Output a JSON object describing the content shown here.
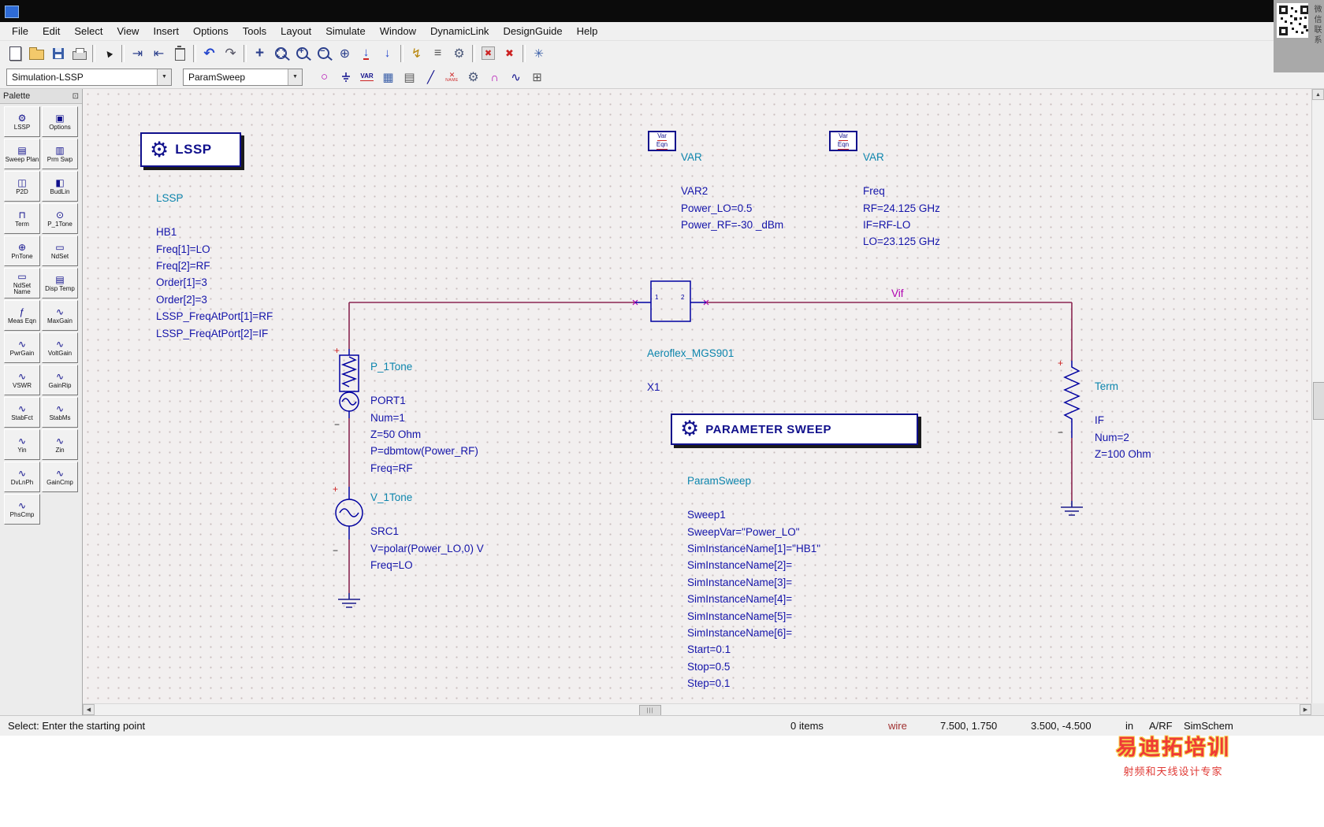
{
  "menu": {
    "items": [
      "File",
      "Edit",
      "Select",
      "View",
      "Insert",
      "Options",
      "Tools",
      "Layout",
      "Simulate",
      "Window",
      "DynamicLink",
      "DesignGuide",
      "Help"
    ]
  },
  "toolbar_main": {
    "icons": [
      "new-design",
      "open-design",
      "save-design",
      "print",
      "select-cursor",
      "push-into-hierarchy",
      "pop-out-hierarchy",
      "delete",
      "undo",
      "redo",
      "move",
      "zoom-area",
      "zoom-in",
      "zoom-out",
      "zoom-full",
      "insert-pin",
      "insert-port",
      "activate",
      "node-name",
      "simulation-setup",
      "deactivate-component",
      "restore-component",
      "preferences"
    ]
  },
  "toolbar_insert": {
    "design_state": "Simulation-LSSP",
    "component_state": "ParamSweep",
    "icons": [
      "insert-polygon",
      "insert-ground",
      "insert-var",
      "display-template",
      "netlist-include",
      "insert-wire",
      "wire-label",
      "simulation-gear",
      "current-probe",
      "measurement-plot",
      "hierarchy"
    ]
  },
  "palette": {
    "title": "Palette",
    "items": [
      {
        "label": "LSSP",
        "glyph": "⚙"
      },
      {
        "label": "Options",
        "glyph": "▣"
      },
      {
        "label": "Sweep Plan",
        "glyph": "▤"
      },
      {
        "label": "Prm Swp",
        "glyph": "▥"
      },
      {
        "label": "P2D",
        "glyph": "◫"
      },
      {
        "label": "BudLin",
        "glyph": "◧"
      },
      {
        "label": "Term",
        "glyph": "⊓"
      },
      {
        "label": "P_1Tone",
        "glyph": "⊙"
      },
      {
        "label": "PnTone",
        "glyph": "⊕"
      },
      {
        "label": "NdSet",
        "glyph": "▭"
      },
      {
        "label": "NdSet Name",
        "glyph": "▭"
      },
      {
        "label": "Disp Temp",
        "glyph": "▤"
      },
      {
        "label": "Meas Eqn",
        "glyph": "ƒ"
      },
      {
        "label": "MaxGain",
        "glyph": "∿"
      },
      {
        "label": "PwrGain",
        "glyph": "∿"
      },
      {
        "label": "VoltGain",
        "glyph": "∿"
      },
      {
        "label": "VSWR",
        "glyph": "∿"
      },
      {
        "label": "GainRip",
        "glyph": "∿"
      },
      {
        "label": "StabFct",
        "glyph": "∿"
      },
      {
        "label": "StabMs",
        "glyph": "∿"
      },
      {
        "label": "Yin",
        "glyph": "∿"
      },
      {
        "label": "Zin",
        "glyph": "∿"
      },
      {
        "label": "DvLnPh",
        "glyph": "∿"
      },
      {
        "label": "GainCmp",
        "glyph": "∿"
      },
      {
        "label": "PhsCmp",
        "glyph": "∿"
      }
    ]
  },
  "schematic": {
    "lssp": {
      "box_title": "LSSP",
      "name": "LSSP",
      "params": [
        "HB1",
        "Freq[1]=LO",
        "Freq[2]=RF",
        "Order[1]=3",
        "Order[2]=3",
        "LSSP_FreqAtPort[1]=RF",
        "LSSP_FreqAtPort[2]=IF"
      ]
    },
    "var2": {
      "icon_lines": [
        "Var",
        "Eqn"
      ],
      "name": "VAR",
      "params": [
        "VAR2",
        "Power_LO=0.5",
        "Power_RF=-30 _dBm"
      ]
    },
    "var_freq": {
      "icon_lines": [
        "Var",
        "Eqn"
      ],
      "name": "VAR",
      "params": [
        "Freq",
        "RF=24.125 GHz",
        "IF=RF-LO",
        "LO=23.125 GHz"
      ]
    },
    "port1": {
      "name": "P_1Tone",
      "params": [
        "PORT1",
        "Num=1",
        "Z=50 Ohm",
        "P=dbmtow(Power_RF)",
        "Freq=RF"
      ]
    },
    "src1": {
      "name": "V_1Tone",
      "params": [
        "SRC1",
        "V=polar(Power_LO,0) V",
        "Freq=LO"
      ]
    },
    "mixer": {
      "name": "Aeroflex_MGS901",
      "instance": "X1",
      "ports": [
        "1",
        "2"
      ]
    },
    "term": {
      "name": "Term",
      "params": [
        "IF",
        "Num=2",
        "Z=100 Ohm"
      ]
    },
    "wire_label": "Vif",
    "psweep": {
      "box_title": "PARAMETER SWEEP",
      "name": "ParamSweep",
      "params": [
        "Sweep1",
        "SweepVar=\"Power_LO\"",
        "SimInstanceName[1]=\"HB1\"",
        "SimInstanceName[2]=",
        "SimInstanceName[3]=",
        "SimInstanceName[4]=",
        "SimInstanceName[5]=",
        "SimInstanceName[6]=",
        "Start=0.1",
        "Stop=0.5",
        "Step=0.1"
      ]
    }
  },
  "statusbar": {
    "message": "Select: Enter the starting point",
    "items_count": "0 items",
    "tool": "wire",
    "cursor_xy": "7.500, 1.750",
    "rel_xy": "3.500, -4.500",
    "units": "in",
    "tech": "A/RF",
    "context": "SimSchem"
  },
  "overlay": {
    "qr_caption": "微信联系",
    "watermark_title": "易迪拓培训",
    "watermark_subtitle": "射频和天线设计专家"
  },
  "colors": {
    "component_symbol": "#0000a0",
    "param_text": "#1414aa",
    "component_name": "#0c85ad",
    "wire": "#8a2550",
    "wire_label": "#b000b0",
    "canvas_bg": "#f2efef"
  }
}
